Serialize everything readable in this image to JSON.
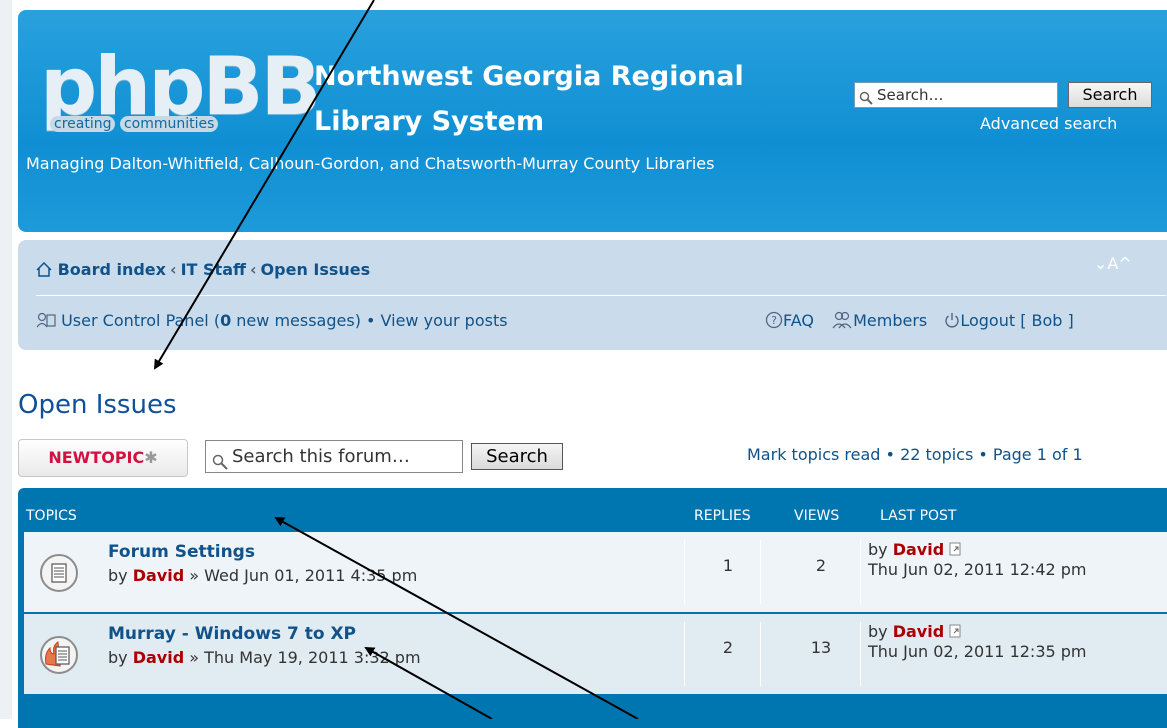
{
  "header": {
    "logo_word": "phpBB",
    "logo_tag_left": "creating",
    "logo_tag_right": "communities",
    "site_title_line1": "Northwest Georgia Regional",
    "site_title_line2": "Library System",
    "site_description": "Managing Dalton-Whitfield, Calhoun-Gordon, and Chatsworth-Murray County Libraries",
    "search_placeholder": "Search…",
    "search_button": "Search",
    "advanced_search": "Advanced search"
  },
  "navbar": {
    "breadcrumbs": [
      "Board index",
      "IT Staff",
      "Open Issues"
    ],
    "font_size_control": "⌄A^",
    "ucp_label": "User Control Panel (",
    "new_messages_count": "0",
    "ucp_suffix": " new messages)",
    "bullet": " • ",
    "view_posts": "View your posts",
    "faq": "FAQ",
    "members": "Members",
    "logout": "Logout [ Bob ]"
  },
  "forum": {
    "title": "Open Issues",
    "new_topic_button": "NEWTOPIC",
    "search_placeholder": "Search this forum…",
    "search_button": "Search",
    "pagination": "Mark topics read • 22 topics • Page 1 of 1"
  },
  "topics_table": {
    "headers": {
      "topics": "TOPICS",
      "replies": "REPLIES",
      "views": "VIEWS",
      "last_post": "LAST POST"
    },
    "rows": [
      {
        "title": "Forum Settings",
        "by": "by ",
        "author": "David",
        "date": " » Wed Jun 01, 2011 4:35 pm",
        "replies": "1",
        "views": "2",
        "last_by": "by ",
        "last_author": "David",
        "last_date": "Thu Jun 02, 2011 12:42 pm",
        "icon": "topic-read-icon"
      },
      {
        "title": "Murray - Windows 7 to XP",
        "by": "by ",
        "author": "David",
        "date": " » Thu May 19, 2011 3:32 pm",
        "replies": "2",
        "views": "13",
        "last_by": "by ",
        "last_author": "David",
        "last_date": "Thu Jun 02, 2011 12:35 pm",
        "icon": "topic-hot-icon"
      }
    ]
  },
  "colors": {
    "header_blue": "#12a0e0",
    "navbar_bg": "#cadceb",
    "link_blue": "#105289",
    "author_red": "#aa0000",
    "new_topic_red": "#d31141"
  }
}
